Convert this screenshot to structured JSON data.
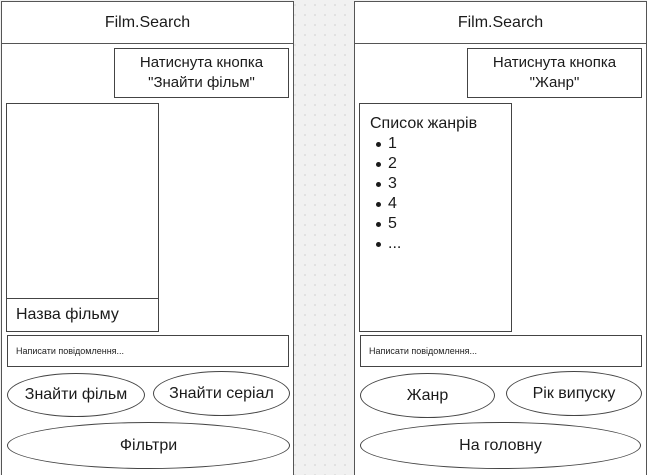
{
  "left_screen": {
    "app_title": "Film.Search",
    "note": "Натиснута кнопка\n\"Знайти фільм\"",
    "poster_caption": "Назва фільму",
    "message_placeholder": "Написати повідомлення...",
    "buttons": {
      "find_film": "Знайти фільм",
      "find_series": "Знайти серіал",
      "filters": "Фільтри"
    }
  },
  "right_screen": {
    "app_title": "Film.Search",
    "note": "Натиснута кнопка\n\"Жанр\"",
    "genre_list": {
      "title": "Список жанрів",
      "items": [
        "1",
        "2",
        "3",
        "4",
        "5",
        "..."
      ]
    },
    "message_placeholder": "Написати повідомлення...",
    "buttons": {
      "genre": "Жанр",
      "release_year": "Рік випуску",
      "home": "На головну"
    }
  }
}
